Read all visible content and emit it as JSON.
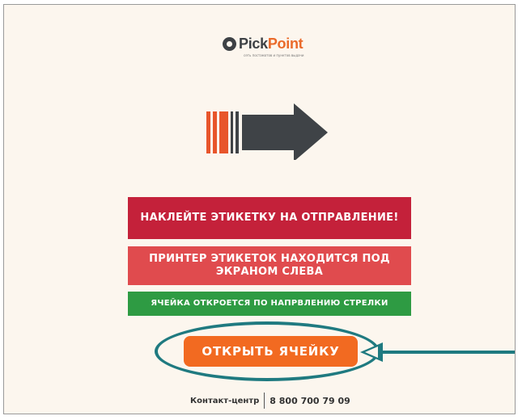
{
  "logo": {
    "name_dark": "Pick",
    "name_accent": "Point",
    "tagline": "сеть постаматов и пунктов выдачи",
    "icon": "pickpoint-logo-icon"
  },
  "arrow": {
    "icon": "direction-arrow-icon",
    "colors": {
      "stripes": "#e8552b",
      "body": "#3f4347"
    }
  },
  "messages": {
    "label_sticker": "НАКЛЕЙТЕ ЭТИКЕТКУ НА ОТПРАВЛЕНИЕ!",
    "printer_location": "ПРИНТЕР ЭТИКЕТОК НАХОДИТСЯ ПОД ЭКРАНОМ СЛЕВА",
    "cell_direction": "ЯЧЕЙКА ОТКРОЕТСЯ ПО НАПРВЛЕНИЮ СТРЕЛКИ"
  },
  "actions": {
    "open_cell_label": "ОТКРЫТЬ ЯЧЕЙКУ"
  },
  "annotation": {
    "highlight_color": "#1f7a80"
  },
  "footer": {
    "contact_label": "Контакт-центр",
    "phone": "8 800 700 79 09"
  },
  "colors": {
    "background": "#fcf6ee",
    "red": "#c4213a",
    "light_red": "#e04b4e",
    "green": "#2e9b43",
    "orange": "#f26a21"
  }
}
